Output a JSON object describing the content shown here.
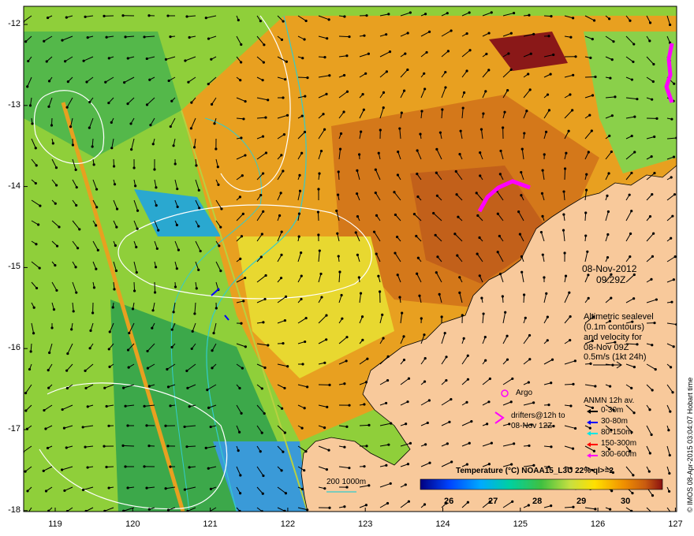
{
  "map": {
    "lat_ticks": [
      "-12",
      "-13",
      "-14",
      "-15",
      "-16",
      "-17",
      "-18"
    ],
    "lon_ticks": [
      "119",
      "120",
      "121",
      "122",
      "123",
      "124",
      "125",
      "126",
      "127"
    ],
    "date": "08-Nov-2012",
    "time": "09:29Z",
    "alt_lines": [
      "Altimetric sealevel",
      "(0.1m contours)",
      "and velocity for",
      "08-Nov 09Z",
      "0.5m/s (1kt 24h)"
    ],
    "argo_label": "Argo",
    "drifters_lines": [
      "drifters@12h to",
      "08-Nov 12Z"
    ],
    "anmn_title": "ANMN 12h av.",
    "anmn_rows": [
      {
        "label": "0-30m",
        "color": "#000000"
      },
      {
        "label": "30-80m",
        "color": "#0000ff"
      },
      {
        "label": "80-150m",
        "color": "#00e5e5"
      },
      {
        "label": "150-300m",
        "color": "#ff0000"
      },
      {
        "label": "300-600m",
        "color": "#ff00ff"
      }
    ],
    "bathy_label": "200  1000m",
    "colorbar_title": "Temperature (°C) NOAA15_L3U 22% ql>=2",
    "colorbar_ticks": [
      "26",
      "27",
      "28",
      "29",
      "30"
    ],
    "credit": "© IMOS 08-Apr-2015 03:04:07 Hobart time",
    "colors": {
      "land": "#f8c99b",
      "argo": "#ff00ff",
      "contour": "#ffffff",
      "bathy": "#33cccc"
    }
  }
}
